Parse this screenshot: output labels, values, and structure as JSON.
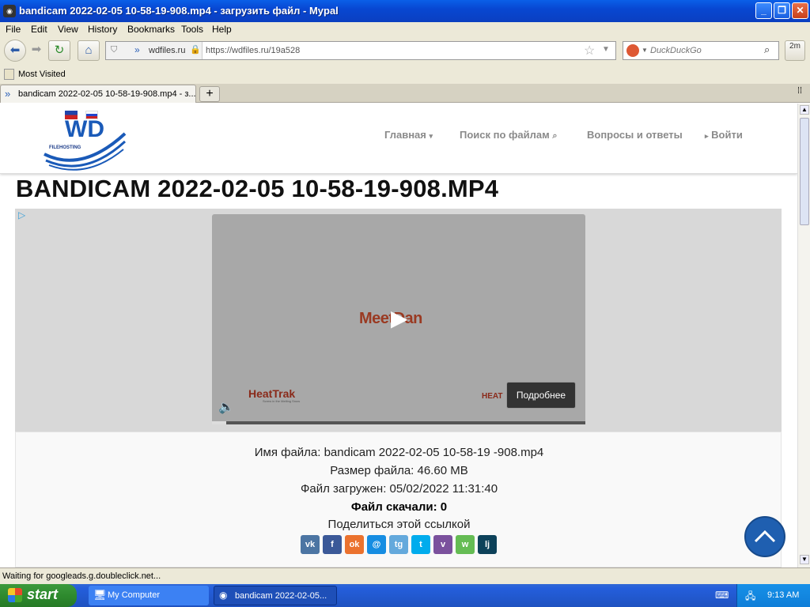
{
  "window": {
    "title": "bandicam 2022-02-05 10-58-19-908.mp4 - загрузить файл - Mypal"
  },
  "menu": [
    "File",
    "Edit",
    "View",
    "History",
    "Bookmarks",
    "Tools",
    "Help"
  ],
  "nav": {
    "site_identity": "wdfiles.ru",
    "url": "https://wdfiles.ru/19a528",
    "search_placeholder": "DuckDuckGo",
    "addon_label": "2m"
  },
  "bookmarks": {
    "most_visited": "Most Visited"
  },
  "tabs": [
    {
      "label": "bandicam 2022-02-05 10-58-19-908.mp4 - з..."
    }
  ],
  "site": {
    "logo_text": "WD",
    "logo_sub": "FILEHOSTING",
    "nav": {
      "home": "Главная",
      "search": "Поиск по файлам",
      "faq": "Вопросы и ответы",
      "login": "Войти"
    }
  },
  "page": {
    "title": "BANDICAM 2022-02-05 10-58-19-908.MP4"
  },
  "ad": {
    "brand_center": "MeetDan",
    "brand_left": "HeatTrak",
    "brand_left_tagline": "Screw in the Melting Snow",
    "brand_right": "HEAT",
    "more_button": "Подробнее"
  },
  "file": {
    "name_line": "Имя файла: bandicam 2022-02-05 10-58-19 -908.mp4",
    "size_line": "Размер файла: 46.60 MB",
    "uploaded_line": "Файл загружен: 05/02/2022 11:31:40",
    "downloads_line": "Файл скачали: 0",
    "share_heading": "Поделиться этой ссылкой"
  },
  "share_buttons": [
    {
      "name": "vk",
      "label": "vk",
      "color": "#4c75a3"
    },
    {
      "name": "facebook",
      "label": "f",
      "color": "#3b5998"
    },
    {
      "name": "odnoklassniki",
      "label": "ok",
      "color": "#eb722e"
    },
    {
      "name": "moimir",
      "label": "@",
      "color": "#168de2"
    },
    {
      "name": "telegram",
      "label": "tg",
      "color": "#64a9dc"
    },
    {
      "name": "twitter",
      "label": "t",
      "color": "#00aced"
    },
    {
      "name": "viber",
      "label": "v",
      "color": "#7b519d"
    },
    {
      "name": "whatsapp",
      "label": "w",
      "color": "#65bc54"
    },
    {
      "name": "livejournal",
      "label": "lj",
      "color": "#0d425a"
    }
  ],
  "status": {
    "text": "Waiting for googleads.g.doubleclick.net..."
  },
  "taskbar": {
    "start": "start",
    "items": [
      "My Computer",
      "bandicam 2022-02-05..."
    ],
    "clock": "9:13 AM"
  },
  "colors": {
    "title_bar": "#0a4fd8",
    "back_to_top": "#1f5fb0",
    "start": "#2e8a2e"
  }
}
